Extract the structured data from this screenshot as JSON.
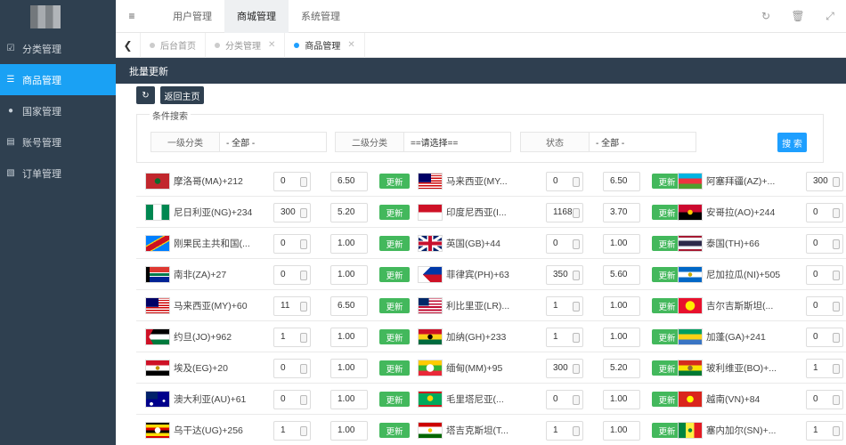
{
  "sidebar": {
    "items": [
      {
        "label": "分类管理",
        "icon": "calendar-check-icon"
      },
      {
        "label": "商品管理",
        "icon": "list-icon",
        "active": true
      },
      {
        "label": "国家管理",
        "icon": "globe-icon"
      },
      {
        "label": "账号管理",
        "icon": "user-card-icon"
      },
      {
        "label": "订单管理",
        "icon": "document-icon"
      }
    ]
  },
  "topbar": {
    "tabs": [
      "用户管理",
      "商城管理",
      "系统管理"
    ],
    "active_tab": "商城管理"
  },
  "pagetabs": [
    "后台首页",
    "分类管理",
    "商品管理"
  ],
  "strip_title": "批量更新",
  "toolbar": {
    "back_label": "返回主页"
  },
  "search": {
    "legend": "条件搜索",
    "fields": [
      {
        "label": "一级分类",
        "value": "- 全部 -"
      },
      {
        "label": "二级分类",
        "value": "==请选择=="
      },
      {
        "label": "状态",
        "value": "- 全部 -"
      }
    ],
    "button": "搜 索"
  },
  "update_label": "更新",
  "rows": [
    [
      {
        "country": "摩洛哥(MA)+212",
        "stock": "0",
        "price": "6.50",
        "flag": "ma"
      },
      {
        "country": "马来西亚(MY...",
        "stock": "0",
        "price": "6.50",
        "flag": "my"
      },
      {
        "country": "阿塞拜疆(AZ)+...",
        "stock": "300",
        "flag": "az"
      }
    ],
    [
      {
        "country": "尼日利亚(NG)+234",
        "stock": "300",
        "price": "5.20",
        "flag": "ng"
      },
      {
        "country": "印度尼西亚(I...",
        "stock": "1168",
        "price": "3.70",
        "flag": "id"
      },
      {
        "country": "安哥拉(AO)+244",
        "stock": "0",
        "flag": "ao"
      }
    ],
    [
      {
        "country": "刚果民主共和国(...",
        "stock": "0",
        "price": "1.00",
        "flag": "cd"
      },
      {
        "country": "英国(GB)+44",
        "stock": "0",
        "price": "1.00",
        "flag": "gb"
      },
      {
        "country": "泰国(TH)+66",
        "stock": "0",
        "flag": "th"
      }
    ],
    [
      {
        "country": "南非(ZA)+27",
        "stock": "0",
        "price": "1.00",
        "flag": "za"
      },
      {
        "country": "菲律宾(PH)+63",
        "stock": "350",
        "price": "5.60",
        "flag": "ph"
      },
      {
        "country": "尼加拉瓜(NI)+505",
        "stock": "0",
        "flag": "ni"
      }
    ],
    [
      {
        "country": "马来西亚(MY)+60",
        "stock": "11",
        "price": "6.50",
        "flag": "my"
      },
      {
        "country": "利比里亚(LR)...",
        "stock": "1",
        "price": "1.00",
        "flag": "lr"
      },
      {
        "country": "吉尔吉斯斯坦(...",
        "stock": "0",
        "flag": "kg"
      }
    ],
    [
      {
        "country": "约旦(JO)+962",
        "stock": "1",
        "price": "1.00",
        "flag": "jo"
      },
      {
        "country": "加纳(GH)+233",
        "stock": "1",
        "price": "1.00",
        "flag": "gh"
      },
      {
        "country": "加蓬(GA)+241",
        "stock": "0",
        "flag": "ga"
      }
    ],
    [
      {
        "country": "埃及(EG)+20",
        "stock": "0",
        "price": "1.00",
        "flag": "eg"
      },
      {
        "country": "缅甸(MM)+95",
        "stock": "300",
        "price": "5.20",
        "flag": "mm"
      },
      {
        "country": "玻利维亚(BO)+...",
        "stock": "1",
        "flag": "bo"
      }
    ],
    [
      {
        "country": "澳大利亚(AU)+61",
        "stock": "0",
        "price": "1.00",
        "flag": "au"
      },
      {
        "country": "毛里塔尼亚(...",
        "stock": "0",
        "price": "1.00",
        "flag": "mr"
      },
      {
        "country": "越南(VN)+84",
        "stock": "0",
        "flag": "vn"
      }
    ],
    [
      {
        "country": "乌干达(UG)+256",
        "stock": "1",
        "price": "1.00",
        "flag": "ug"
      },
      {
        "country": "塔吉克斯坦(T...",
        "stock": "1",
        "price": "1.00",
        "flag": "tj"
      },
      {
        "country": "塞内加尔(SN)+...",
        "stock": "1",
        "flag": "sn"
      }
    ]
  ]
}
